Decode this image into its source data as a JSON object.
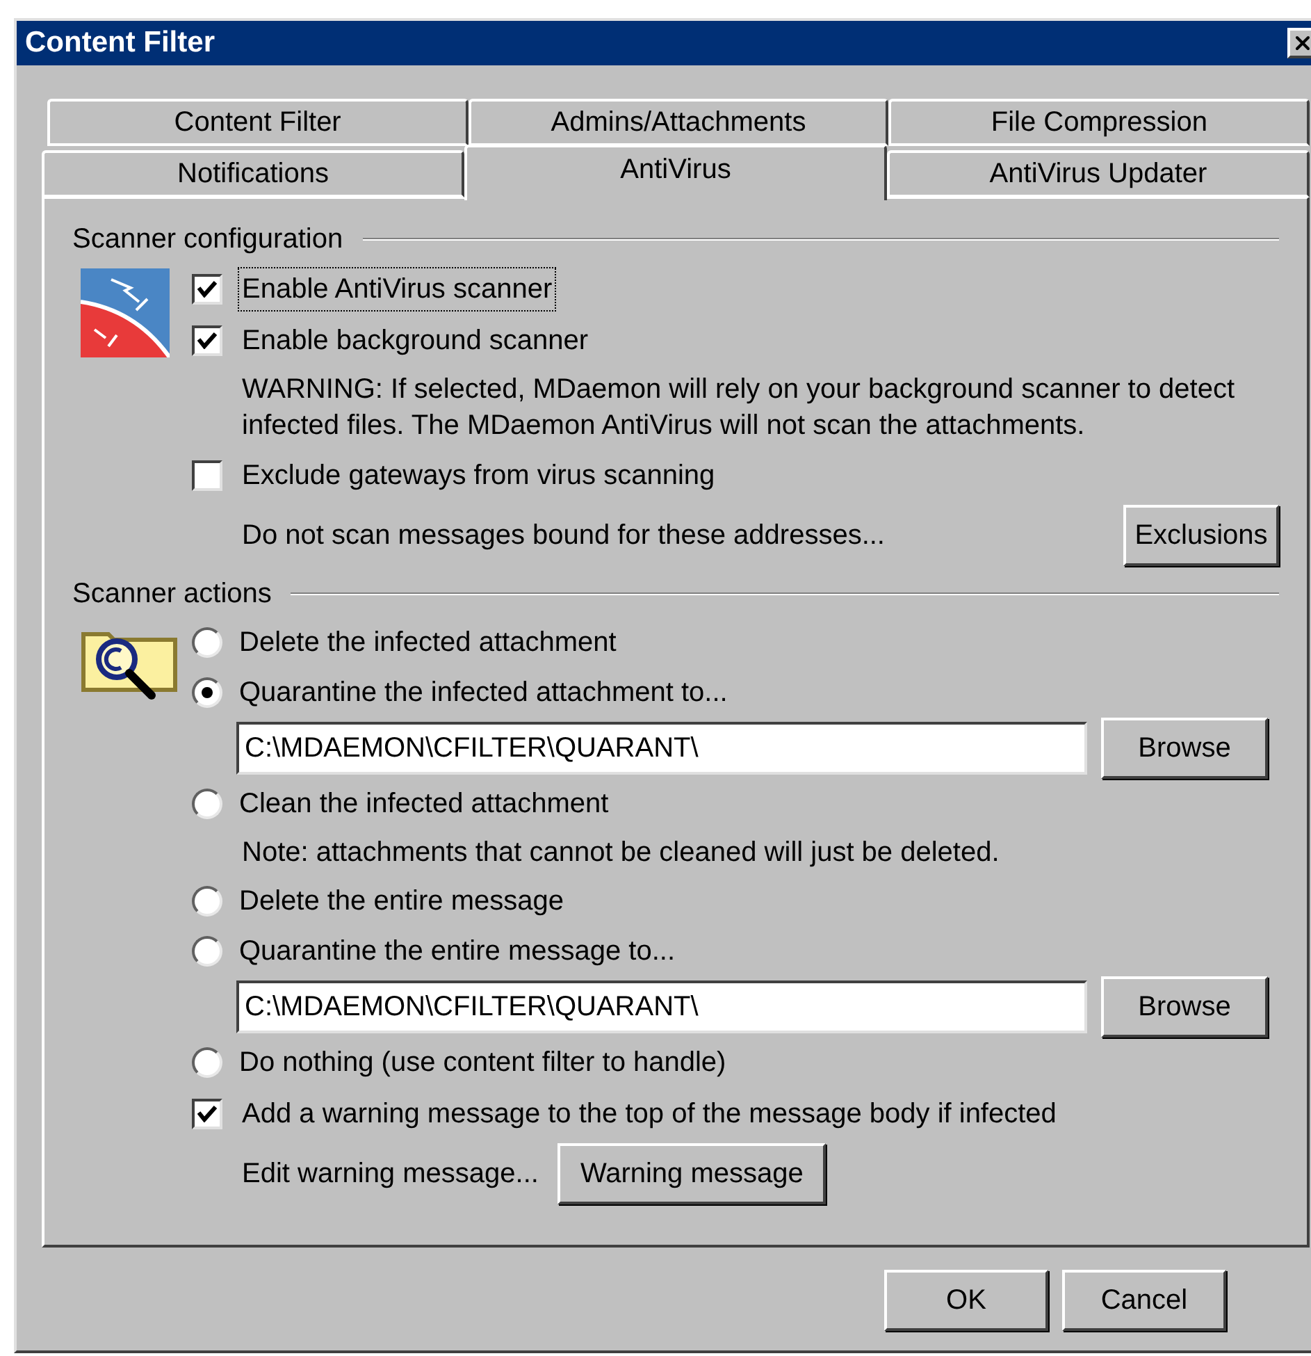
{
  "window": {
    "title": "Content Filter"
  },
  "tab_rows": [
    {
      "tabs": [
        {
          "label": "Content Filter",
          "selected": false
        },
        {
          "label": "Admins/Attachments",
          "selected": false
        },
        {
          "label": "File Compression",
          "selected": false
        }
      ]
    },
    {
      "tabs": [
        {
          "label": "Notifications",
          "selected": false
        },
        {
          "label": "AntiVirus",
          "selected": true
        },
        {
          "label": "AntiVirus Updater",
          "selected": false
        }
      ]
    }
  ],
  "sections": [
    {
      "title": "Scanner configuration",
      "items": [
        {
          "kind": "checkbox",
          "label": "Enable AntiVirus scanner",
          "checked": true,
          "focused": true
        },
        {
          "kind": "checkbox",
          "label": "Enable background scanner",
          "checked": true,
          "focused": false
        },
        {
          "kind": "note",
          "text": "WARNING:  If selected, MDaemon will rely on your background scanner to detect infected files.  The MDaemon AntiVirus will not scan the attachments."
        },
        {
          "kind": "checkbox",
          "label": "Exclude gateways from virus scanning",
          "checked": false,
          "focused": false
        },
        {
          "kind": "aside_row",
          "text": "Do not scan messages bound for these addresses...",
          "button": "Exclusions"
        }
      ]
    },
    {
      "title": "Scanner actions",
      "items": [
        {
          "kind": "radio",
          "label": "Delete the infected attachment",
          "selected": false
        },
        {
          "kind": "radio",
          "label": "Quarantine the infected attachment to...",
          "selected": true
        },
        {
          "kind": "path",
          "value": "C:\\MDAEMON\\CFILTER\\QUARANT\\",
          "button": "Browse"
        },
        {
          "kind": "radio",
          "label": "Clean the infected attachment",
          "selected": false
        },
        {
          "kind": "note",
          "text": "Note: attachments that cannot be cleaned will just be deleted."
        },
        {
          "kind": "radio",
          "label": "Delete the entire message",
          "selected": false
        },
        {
          "kind": "radio",
          "label": "Quarantine the entire message to...",
          "selected": false
        },
        {
          "kind": "path",
          "value": "C:\\MDAEMON\\CFILTER\\QUARANT\\",
          "button": "Browse"
        },
        {
          "kind": "radio",
          "label": "Do nothing (use content filter to handle)",
          "selected": false
        },
        {
          "kind": "checkbox",
          "label": "Add a warning message to the top of the message body if infected",
          "checked": true,
          "focused": false
        },
        {
          "kind": "button_row",
          "text": "Edit warning message...",
          "button": "Warning message"
        }
      ]
    }
  ],
  "buttons": [
    "OK",
    "Cancel"
  ]
}
